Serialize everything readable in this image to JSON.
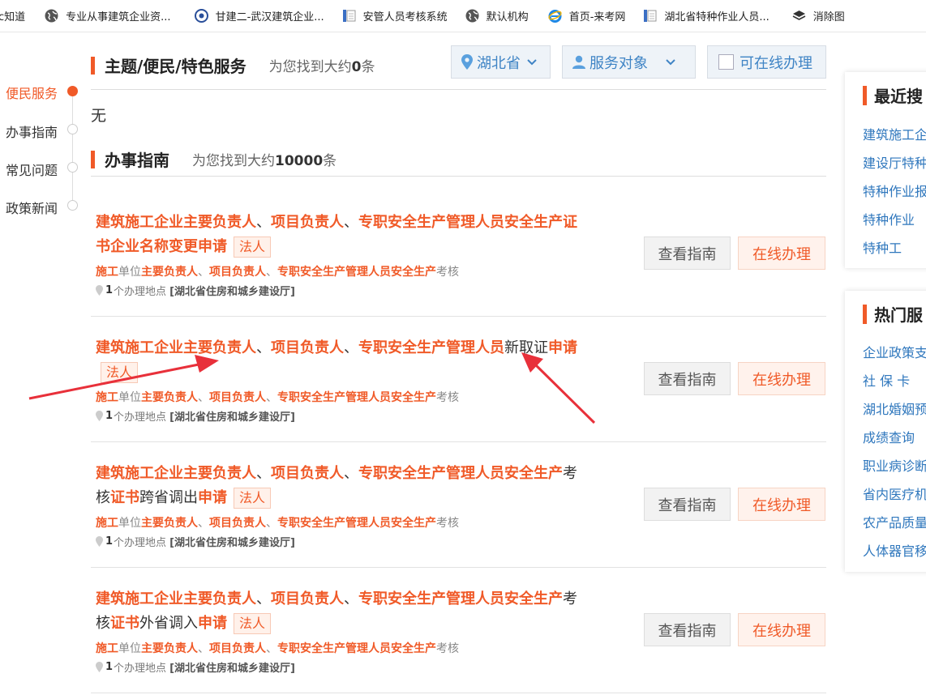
{
  "bookmarks": [
    {
      "label": "c知道",
      "icon": "none"
    },
    {
      "label": "专业从事建筑企业资...",
      "icon": "globe-icon"
    },
    {
      "label": "甘建二-武汉建筑企业...",
      "icon": "site-logo-icon"
    },
    {
      "label": "安管人员考核系统",
      "icon": "page-icon"
    },
    {
      "label": "默认机构",
      "icon": "globe-icon"
    },
    {
      "label": "首页-来考网",
      "icon": "ie-icon"
    },
    {
      "label": "湖北省特种作业人员...",
      "icon": "page-icon"
    },
    {
      "label": "消除图",
      "icon": "layers-icon"
    }
  ],
  "left_nav": [
    {
      "label": "便民服务",
      "active": true
    },
    {
      "label": "办事指南",
      "active": false
    },
    {
      "label": "常见问题",
      "active": false
    },
    {
      "label": "政策新闻",
      "active": false
    }
  ],
  "section1": {
    "title": "主题/便民/特色服务",
    "count_prefix": "为您找到大约",
    "count": "0",
    "count_suffix": "条",
    "empty_text": "无"
  },
  "filters": {
    "region": "湖北省",
    "audience": "服务对象",
    "online_only": "可在线办理",
    "online_only_checked": false
  },
  "section2": {
    "title": "办事指南",
    "count_prefix": "为您找到大约",
    "count": "10000",
    "count_suffix": "条"
  },
  "buttons": {
    "guide": "查看指南",
    "online": "在线办理"
  },
  "results": [
    {
      "title_line1": [
        {
          "text": "建筑施工企业主要负责人",
          "hl": true
        },
        {
          "text": "、",
          "hl": false
        },
        {
          "text": "项目负责人",
          "hl": true
        },
        {
          "text": "、",
          "hl": false
        },
        {
          "text": "专职安全生产管理人员安全生产证",
          "hl": true
        }
      ],
      "title_line2": [
        {
          "text": "书企业名称变更申请",
          "hl": true
        }
      ],
      "tag": "法人",
      "sub": [
        {
          "text": "施工",
          "hl": true
        },
        {
          "text": "单位",
          "hl": false
        },
        {
          "text": "主要负责人",
          "hl": true
        },
        {
          "text": "、",
          "hl": false
        },
        {
          "text": "项目负责人",
          "hl": true
        },
        {
          "text": "、",
          "hl": false
        },
        {
          "text": "专职安全生产管理人员安全生产",
          "hl": true
        },
        {
          "text": "考核",
          "hl": false
        }
      ],
      "location_count": "1",
      "location_label": "个办理地点",
      "location_dept": "[湖北省住房和城乡建设厅]"
    },
    {
      "title_line1": [
        {
          "text": "建筑施工企业主要负责人",
          "hl": true
        },
        {
          "text": "、",
          "hl": false
        },
        {
          "text": "项目负责人",
          "hl": true
        },
        {
          "text": "、",
          "hl": false
        },
        {
          "text": "专职安全生产管理人员",
          "hl": true
        },
        {
          "text": "新取证",
          "hl": false
        },
        {
          "text": "申请",
          "hl": true
        }
      ],
      "title_line2": [],
      "tag": "法人",
      "sub": [
        {
          "text": "施工",
          "hl": true
        },
        {
          "text": "单位",
          "hl": false
        },
        {
          "text": "主要负责人",
          "hl": true
        },
        {
          "text": "、",
          "hl": false
        },
        {
          "text": "项目负责人",
          "hl": true
        },
        {
          "text": "、",
          "hl": false
        },
        {
          "text": "专职安全生产管理人员安全生产",
          "hl": true
        },
        {
          "text": "考核",
          "hl": false
        }
      ],
      "location_count": "1",
      "location_label": "个办理地点",
      "location_dept": "[湖北省住房和城乡建设厅]"
    },
    {
      "title_line1": [
        {
          "text": "建筑施工企业主要负责人",
          "hl": true
        },
        {
          "text": "、",
          "hl": false
        },
        {
          "text": "项目负责人",
          "hl": true
        },
        {
          "text": "、",
          "hl": false
        },
        {
          "text": "专职安全生产管理人员安全生产",
          "hl": true
        },
        {
          "text": "考",
          "hl": false
        }
      ],
      "title_line2": [
        {
          "text": "核",
          "hl": false
        },
        {
          "text": "证书",
          "hl": true
        },
        {
          "text": "跨省调出",
          "hl": false
        },
        {
          "text": "申请",
          "hl": true
        }
      ],
      "tag": "法人",
      "sub": [
        {
          "text": "施工",
          "hl": true
        },
        {
          "text": "单位",
          "hl": false
        },
        {
          "text": "主要负责人",
          "hl": true
        },
        {
          "text": "、",
          "hl": false
        },
        {
          "text": "项目负责人",
          "hl": true
        },
        {
          "text": "、",
          "hl": false
        },
        {
          "text": "专职安全生产管理人员安全生产",
          "hl": true
        },
        {
          "text": "考核",
          "hl": false
        }
      ],
      "location_count": "1",
      "location_label": "个办理地点",
      "location_dept": "[湖北省住房和城乡建设厅]"
    },
    {
      "title_line1": [
        {
          "text": "建筑施工企业主要负责人",
          "hl": true
        },
        {
          "text": "、",
          "hl": false
        },
        {
          "text": "项目负责人",
          "hl": true
        },
        {
          "text": "、",
          "hl": false
        },
        {
          "text": "专职安全生产管理人员安全生产",
          "hl": true
        },
        {
          "text": "考",
          "hl": false
        }
      ],
      "title_line2": [
        {
          "text": "核",
          "hl": false
        },
        {
          "text": "证书",
          "hl": true
        },
        {
          "text": "外省调入",
          "hl": false
        },
        {
          "text": "申请",
          "hl": true
        }
      ],
      "tag": "法人",
      "sub": [
        {
          "text": "施工",
          "hl": true
        },
        {
          "text": "单位",
          "hl": false
        },
        {
          "text": "主要负责人",
          "hl": true
        },
        {
          "text": "、",
          "hl": false
        },
        {
          "text": "项目负责人",
          "hl": true
        },
        {
          "text": "、",
          "hl": false
        },
        {
          "text": "专职安全生产管理人员安全生产",
          "hl": true
        },
        {
          "text": "考核",
          "hl": false
        }
      ],
      "location_count": "1",
      "location_label": "个办理地点",
      "location_dept": "[湖北省住房和城乡建设厅]"
    }
  ],
  "recent_search": {
    "title": "最近搜",
    "items": [
      "建筑施工企",
      "建设厅特种",
      "特种作业报",
      "特种作业",
      "特种工"
    ]
  },
  "hot_services": {
    "title": "热门服",
    "items": [
      "企业政策支",
      "社 保 卡",
      "湖北婚姻预",
      "成绩查询",
      "职业病诊断",
      "省内医疗机",
      "农产品质量",
      "人体器官移"
    ]
  },
  "colors": {
    "accent": "#f05a28",
    "link": "#2f77bd",
    "annotation_arrow": "#e8303a"
  }
}
